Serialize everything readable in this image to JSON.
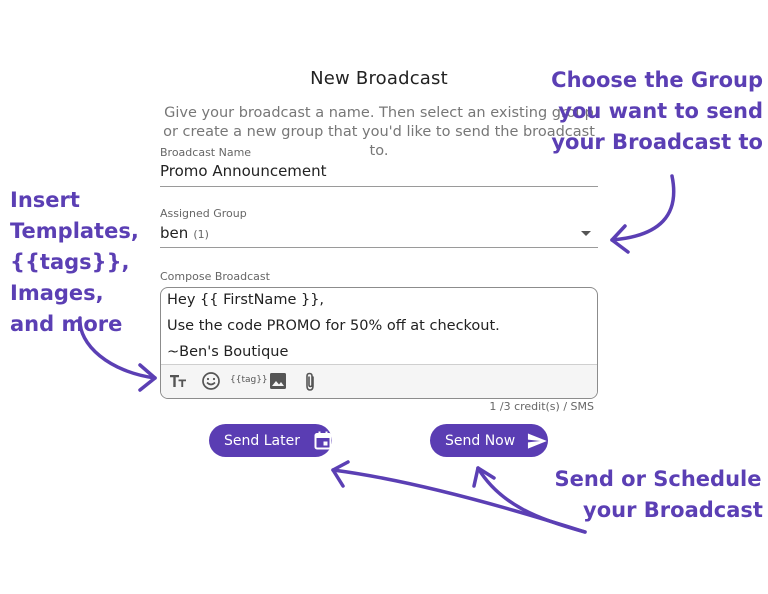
{
  "page": {
    "title": "New Broadcast",
    "subtitle": "Give your broadcast a name. Then select an existing group or create a new group that you'd like to send the broadcast to."
  },
  "broadcast_name": {
    "label": "Broadcast Name",
    "value": "Promo Announcement"
  },
  "assigned_group": {
    "label": "Assigned Group",
    "value": "ben",
    "count": "(1)",
    "icon": "dropdown-arrow-icon"
  },
  "compose": {
    "label": "Compose Broadcast",
    "lines": [
      "Hey {{ FirstName }},",
      "Use the code PROMO for 50% off at checkout.",
      "~Ben's Boutique"
    ],
    "toolbar": {
      "format_icon": "text-format-icon",
      "emoji_icon": "emoji-icon",
      "tag_label": "{{tag}}",
      "image_icon": "image-icon",
      "attach_icon": "paperclip-icon"
    },
    "credits": "1 /3 credit(s) / SMS"
  },
  "buttons": {
    "send_later": "Send Later",
    "send_later_icon": "calendar-icon",
    "send_now": "Send Now",
    "send_now_icon": "send-icon"
  },
  "annotations": {
    "group": [
      "Choose the Group",
      "you want to send",
      "your Broadcast to"
    ],
    "insert": [
      "Insert",
      "Templates,",
      "{{tags}}, Images,",
      "and more"
    ],
    "send": [
      "Send or Schedule",
      "your Broadcast"
    ]
  },
  "colors": {
    "accent": "#5a3db3",
    "annotation": "#5b3fb4"
  }
}
